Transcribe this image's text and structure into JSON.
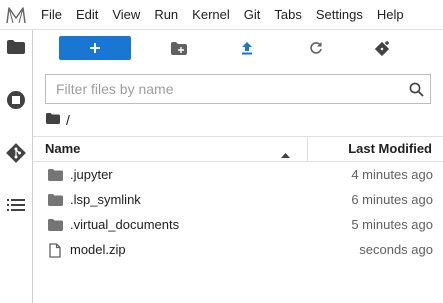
{
  "menubar": {
    "logo_icon": "jupyter-logo-icon",
    "items": [
      "File",
      "Edit",
      "View",
      "Run",
      "Kernel",
      "Git",
      "Tabs",
      "Settings",
      "Help"
    ]
  },
  "left_sidebar": {
    "items": [
      {
        "icon": "folder-icon"
      },
      {
        "icon": "running-sessions-icon"
      },
      {
        "icon": "git-icon"
      },
      {
        "icon": "table-of-contents-icon"
      }
    ]
  },
  "toolbar": {
    "new_launcher_icon": "plus-icon",
    "new_folder_icon": "new-folder-icon",
    "upload_icon": "upload-icon",
    "refresh_icon": "refresh-icon",
    "git_clone_icon": "git-clone-icon"
  },
  "filter": {
    "placeholder": "Filter files by name",
    "value": ""
  },
  "breadcrumbs": {
    "root": "/"
  },
  "listing": {
    "columns": {
      "name": "Name",
      "modified": "Last Modified"
    },
    "rows": [
      {
        "name": ".jupyter",
        "modified": "4 minutes ago",
        "type": "folder"
      },
      {
        "name": ".lsp_symlink",
        "modified": "6 minutes ago",
        "type": "folder"
      },
      {
        "name": ".virtual_documents",
        "modified": "5 minutes ago",
        "type": "folder"
      },
      {
        "name": "model.zip",
        "modified": "seconds ago",
        "type": "file"
      }
    ]
  },
  "colors": {
    "accent": "#1976d2",
    "icon": "#616161"
  }
}
